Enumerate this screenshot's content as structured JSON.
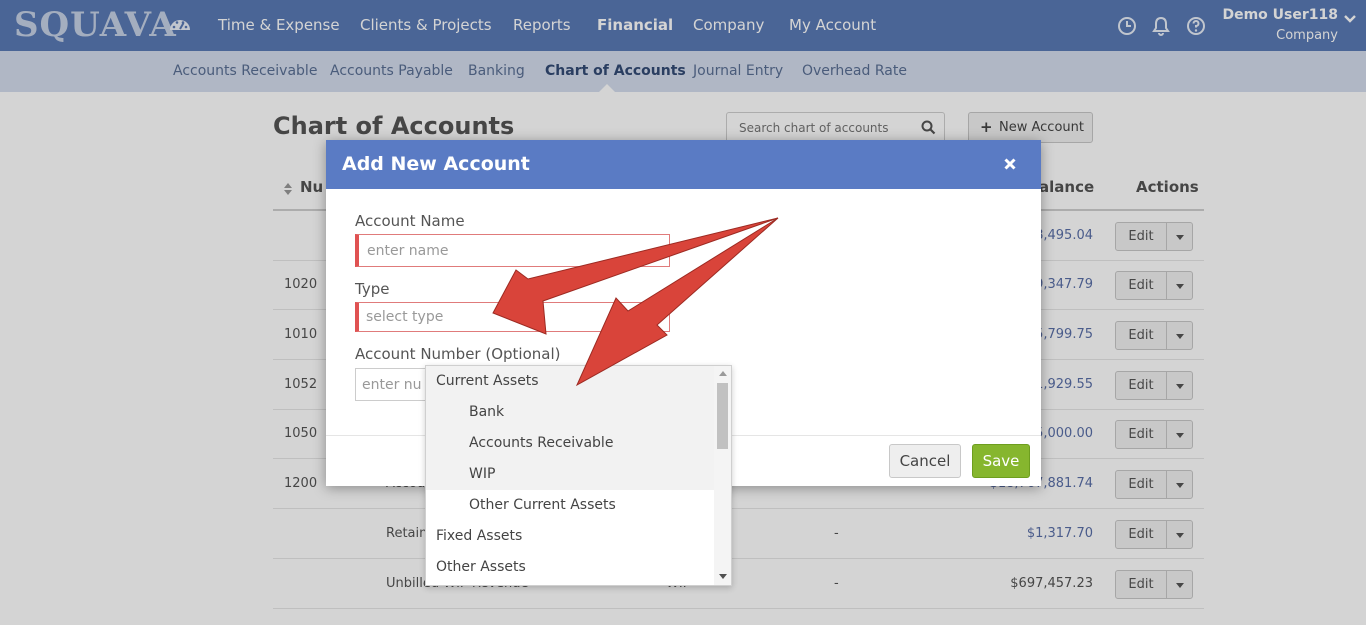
{
  "brand": "SQUAVA",
  "nav": {
    "items": [
      "Time & Expense",
      "Clients & Projects",
      "Reports",
      "Financial",
      "Company",
      "My Account"
    ],
    "active": "Financial"
  },
  "user": {
    "name": "Demo User118",
    "company": "Company"
  },
  "subnav": {
    "items": [
      "Accounts Receivable",
      "Accounts Payable",
      "Banking",
      "Chart of Accounts",
      "Journal Entry",
      "Overhead Rate"
    ],
    "active": "Chart of Accounts"
  },
  "page": {
    "title": "Chart of Accounts",
    "search_placeholder": "Search chart of accounts",
    "new_account": "New Account"
  },
  "table": {
    "headers": {
      "number": "Nu",
      "balance": "alance",
      "actions": "Actions"
    },
    "edit_label": "Edit",
    "rows": [
      {
        "number": "",
        "name": "",
        "type": "",
        "desc": "",
        "balance": "8,495.04"
      },
      {
        "number": "1020",
        "name": "",
        "type": "",
        "desc": "",
        "balance": "9,347.79"
      },
      {
        "number": "1010",
        "name": "",
        "type": "",
        "desc": "",
        "balance": "5,799.75"
      },
      {
        "number": "1052",
        "name": "",
        "type": "",
        "desc": "",
        "balance": "1,929.55"
      },
      {
        "number": "1050",
        "name": "",
        "type": "",
        "desc": "",
        "balance": "5,000.00"
      },
      {
        "number": "1200",
        "name": "Accou",
        "type": "eceivable",
        "desc": "-",
        "balance": "-$18,767,881.74"
      },
      {
        "number": "",
        "name": "Retain",
        "type": "eceivable",
        "desc": "-",
        "balance": "$1,317.70"
      },
      {
        "number": "",
        "name": "Unbilled WIP Revenue",
        "type": "WIP",
        "desc": "-",
        "balance": "$697,457.23"
      }
    ]
  },
  "modal": {
    "title": "Add New Account",
    "account_name_label": "Account Name",
    "account_name_placeholder": "enter name",
    "type_label": "Type",
    "type_placeholder": "select type",
    "account_number_label": "Account Number (Optional)",
    "account_number_placeholder": "enter nu",
    "cancel": "Cancel",
    "save": "Save"
  },
  "type_dropdown": {
    "options": [
      {
        "label": "Current Assets",
        "level": "group"
      },
      {
        "label": "Bank",
        "level": "child"
      },
      {
        "label": "Accounts Receivable",
        "level": "child"
      },
      {
        "label": "WIP",
        "level": "child"
      },
      {
        "label": "Other Current Assets",
        "level": "child"
      },
      {
        "label": "Fixed Assets",
        "level": "group"
      },
      {
        "label": "Other Assets",
        "level": "group"
      }
    ],
    "highlighted_count": 4
  },
  "colors": {
    "header": "#5a7ab5",
    "subnav": "#d4dced",
    "modal_header": "#5a7bc4",
    "save": "#86b62e",
    "error_border": "#e05252",
    "annotation_arrow": "#d9443a"
  }
}
